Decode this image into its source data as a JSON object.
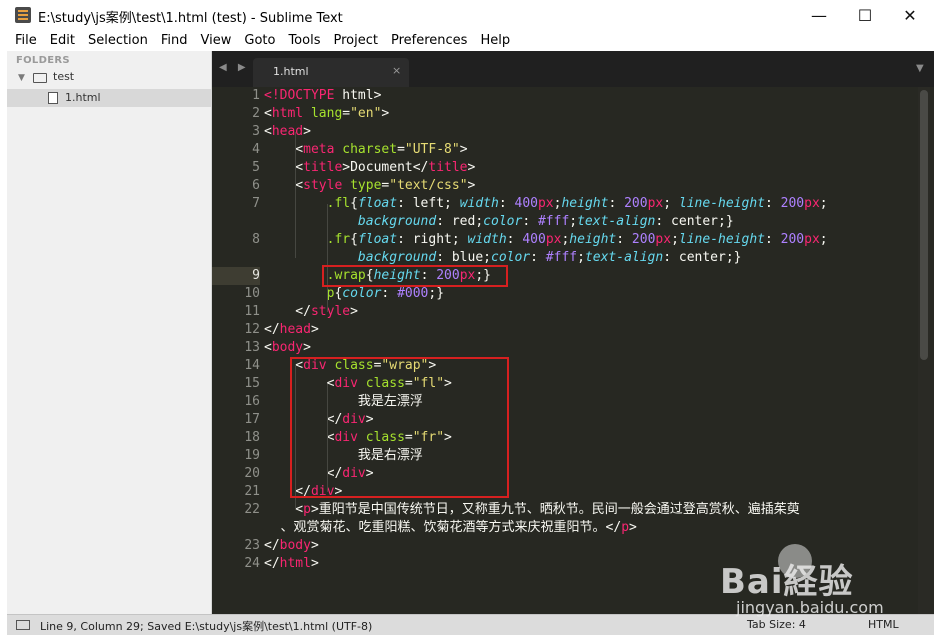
{
  "window": {
    "title": "E:\\study\\js案例\\test\\1.html (test) - Sublime Text",
    "minimize": "—",
    "maximize": "☐",
    "close": "✕"
  },
  "menu": [
    "File",
    "Edit",
    "Selection",
    "Find",
    "View",
    "Goto",
    "Tools",
    "Project",
    "Preferences",
    "Help"
  ],
  "sidebar": {
    "header": "FOLDERS",
    "folder": "test",
    "file": "1.html"
  },
  "tabs": {
    "nav": "◀ ▶",
    "active": "1.html",
    "close": "×",
    "dropdown": "▼"
  },
  "editor": {
    "line_numbers": [
      "1",
      "2",
      "3",
      "4",
      "5",
      "6",
      "7",
      "",
      "8",
      "",
      "9",
      "10",
      "11",
      "12",
      "13",
      "14",
      "15",
      "16",
      "17",
      "18",
      "19",
      "20",
      "21",
      "22",
      "",
      "23",
      "24"
    ],
    "active_line": "9",
    "lines": [
      [
        [
          "tag",
          "<!DOCTYPE"
        ],
        [
          "plain",
          " html>"
        ]
      ],
      [
        [
          "plain",
          "<"
        ],
        [
          "tag",
          "html"
        ],
        [
          "plain",
          " "
        ],
        [
          "attr",
          "lang"
        ],
        [
          "plain",
          "="
        ],
        [
          "str",
          "\"en\""
        ],
        [
          "plain",
          ">"
        ]
      ],
      [
        [
          "plain",
          "<"
        ],
        [
          "tag",
          "head"
        ],
        [
          "plain",
          ">"
        ]
      ],
      [
        [
          "plain",
          "    <"
        ],
        [
          "tag",
          "meta"
        ],
        [
          "plain",
          " "
        ],
        [
          "attr",
          "charset"
        ],
        [
          "plain",
          "="
        ],
        [
          "str",
          "\"UTF-8\""
        ],
        [
          "plain",
          ">"
        ]
      ],
      [
        [
          "plain",
          "    <"
        ],
        [
          "tag",
          "title"
        ],
        [
          "plain",
          ">Document</"
        ],
        [
          "tag",
          "title"
        ],
        [
          "plain",
          ">"
        ]
      ],
      [
        [
          "plain",
          "    <"
        ],
        [
          "tag",
          "style"
        ],
        [
          "plain",
          " "
        ],
        [
          "attr",
          "type"
        ],
        [
          "plain",
          "="
        ],
        [
          "str",
          "\"text/css\""
        ],
        [
          "plain",
          ">"
        ]
      ],
      [
        [
          "plain",
          "        "
        ],
        [
          "sel",
          ".fl"
        ],
        [
          "plain",
          "{"
        ],
        [
          "prop",
          "float"
        ],
        [
          "plain",
          ": left; "
        ],
        [
          "prop",
          "width"
        ],
        [
          "plain",
          ": "
        ],
        [
          "num",
          "400"
        ],
        [
          "tag",
          "px"
        ],
        [
          "plain",
          ";"
        ],
        [
          "prop",
          "height"
        ],
        [
          "plain",
          ": "
        ],
        [
          "num",
          "200"
        ],
        [
          "tag",
          "px"
        ],
        [
          "plain",
          "; "
        ],
        [
          "prop",
          "line-height"
        ],
        [
          "plain",
          ": "
        ],
        [
          "num",
          "200"
        ],
        [
          "tag",
          "px"
        ],
        [
          "plain",
          ";"
        ]
      ],
      [
        [
          "plain",
          "            "
        ],
        [
          "prop",
          "background"
        ],
        [
          "plain",
          ": red;"
        ],
        [
          "prop",
          "color"
        ],
        [
          "plain",
          ": "
        ],
        [
          "num",
          "#fff"
        ],
        [
          "plain",
          ";"
        ],
        [
          "prop",
          "text-align"
        ],
        [
          "plain",
          ": center;}"
        ]
      ],
      [
        [
          "plain",
          "        "
        ],
        [
          "sel",
          ".fr"
        ],
        [
          "plain",
          "{"
        ],
        [
          "prop",
          "float"
        ],
        [
          "plain",
          ": right; "
        ],
        [
          "prop",
          "width"
        ],
        [
          "plain",
          ": "
        ],
        [
          "num",
          "400"
        ],
        [
          "tag",
          "px"
        ],
        [
          "plain",
          ";"
        ],
        [
          "prop",
          "height"
        ],
        [
          "plain",
          ": "
        ],
        [
          "num",
          "200"
        ],
        [
          "tag",
          "px"
        ],
        [
          "plain",
          ";"
        ],
        [
          "prop",
          "line-height"
        ],
        [
          "plain",
          ": "
        ],
        [
          "num",
          "200"
        ],
        [
          "tag",
          "px"
        ],
        [
          "plain",
          ";"
        ]
      ],
      [
        [
          "plain",
          "            "
        ],
        [
          "prop",
          "background"
        ],
        [
          "plain",
          ": blue;"
        ],
        [
          "prop",
          "color"
        ],
        [
          "plain",
          ": "
        ],
        [
          "num",
          "#fff"
        ],
        [
          "plain",
          ";"
        ],
        [
          "prop",
          "text-align"
        ],
        [
          "plain",
          ": center;}"
        ]
      ],
      [
        [
          "plain",
          "        "
        ],
        [
          "sel",
          ".wrap"
        ],
        [
          "plain",
          "{"
        ],
        [
          "prop",
          "height"
        ],
        [
          "plain",
          ": "
        ],
        [
          "num",
          "200"
        ],
        [
          "tag",
          "px"
        ],
        [
          "plain",
          ";}"
        ]
      ],
      [
        [
          "plain",
          "        "
        ],
        [
          "sel",
          "p"
        ],
        [
          "plain",
          "{"
        ],
        [
          "prop",
          "color"
        ],
        [
          "plain",
          ": "
        ],
        [
          "num",
          "#000"
        ],
        [
          "plain",
          ";}"
        ]
      ],
      [
        [
          "plain",
          "    </"
        ],
        [
          "tag",
          "style"
        ],
        [
          "plain",
          ">"
        ]
      ],
      [
        [
          "plain",
          "</"
        ],
        [
          "tag",
          "head"
        ],
        [
          "plain",
          ">"
        ]
      ],
      [
        [
          "plain",
          "<"
        ],
        [
          "tag",
          "body"
        ],
        [
          "plain",
          ">"
        ]
      ],
      [
        [
          "plain",
          "    <"
        ],
        [
          "tag",
          "div"
        ],
        [
          "plain",
          " "
        ],
        [
          "attr",
          "class"
        ],
        [
          "plain",
          "="
        ],
        [
          "str",
          "\"wrap\""
        ],
        [
          "plain",
          ">"
        ]
      ],
      [
        [
          "plain",
          "        <"
        ],
        [
          "tag",
          "div"
        ],
        [
          "plain",
          " "
        ],
        [
          "attr",
          "class"
        ],
        [
          "plain",
          "="
        ],
        [
          "str",
          "\"fl\""
        ],
        [
          "plain",
          ">"
        ]
      ],
      [
        [
          "plain",
          "            "
        ],
        [
          "cjk",
          "我是左漂浮"
        ]
      ],
      [
        [
          "plain",
          "        </"
        ],
        [
          "tag",
          "div"
        ],
        [
          "plain",
          ">"
        ]
      ],
      [
        [
          "plain",
          "        <"
        ],
        [
          "tag",
          "div"
        ],
        [
          "plain",
          " "
        ],
        [
          "attr",
          "class"
        ],
        [
          "plain",
          "="
        ],
        [
          "str",
          "\"fr\""
        ],
        [
          "plain",
          ">"
        ]
      ],
      [
        [
          "plain",
          "            "
        ],
        [
          "cjk",
          "我是右漂浮"
        ]
      ],
      [
        [
          "plain",
          "        </"
        ],
        [
          "tag",
          "div"
        ],
        [
          "plain",
          ">"
        ]
      ],
      [
        [
          "plain",
          "    </"
        ],
        [
          "tag",
          "div"
        ],
        [
          "plain",
          ">"
        ]
      ],
      [
        [
          "plain",
          "    <"
        ],
        [
          "tag",
          "p"
        ],
        [
          "plain",
          ">"
        ],
        [
          "cjk",
          "重阳节是中国传统节日，又称重九节、晒秋节。民间一般会通过登高赏秋、遍插茱萸"
        ]
      ],
      [
        [
          "cjk",
          "    、观赏菊花、吃重阳糕、饮菊花酒等方式来庆祝重阳节。"
        ],
        [
          "plain",
          "</"
        ],
        [
          "tag",
          "p"
        ],
        [
          "plain",
          ">"
        ]
      ],
      [
        [
          "plain",
          "</"
        ],
        [
          "tag",
          "body"
        ],
        [
          "plain",
          ">"
        ]
      ],
      [
        [
          "plain",
          "</"
        ],
        [
          "tag",
          "html"
        ],
        [
          "plain",
          ">"
        ]
      ]
    ]
  },
  "statusbar": {
    "text": "Line 9, Column 29; Saved E:\\study\\js案例\\test\\1.html (UTF-8)",
    "tab_size": "Tab Size: 4",
    "syntax": "HTML"
  },
  "watermark": {
    "brand": "Bai経验",
    "url": "jingyan.baidu.com"
  },
  "colors": {
    "editor_bg": "#272822",
    "tag": "#f92672",
    "attribute": "#a6e22e",
    "string": "#e6db74",
    "property": "#66d9ef",
    "number": "#ae81ff",
    "highlight_box": "#d62020"
  }
}
